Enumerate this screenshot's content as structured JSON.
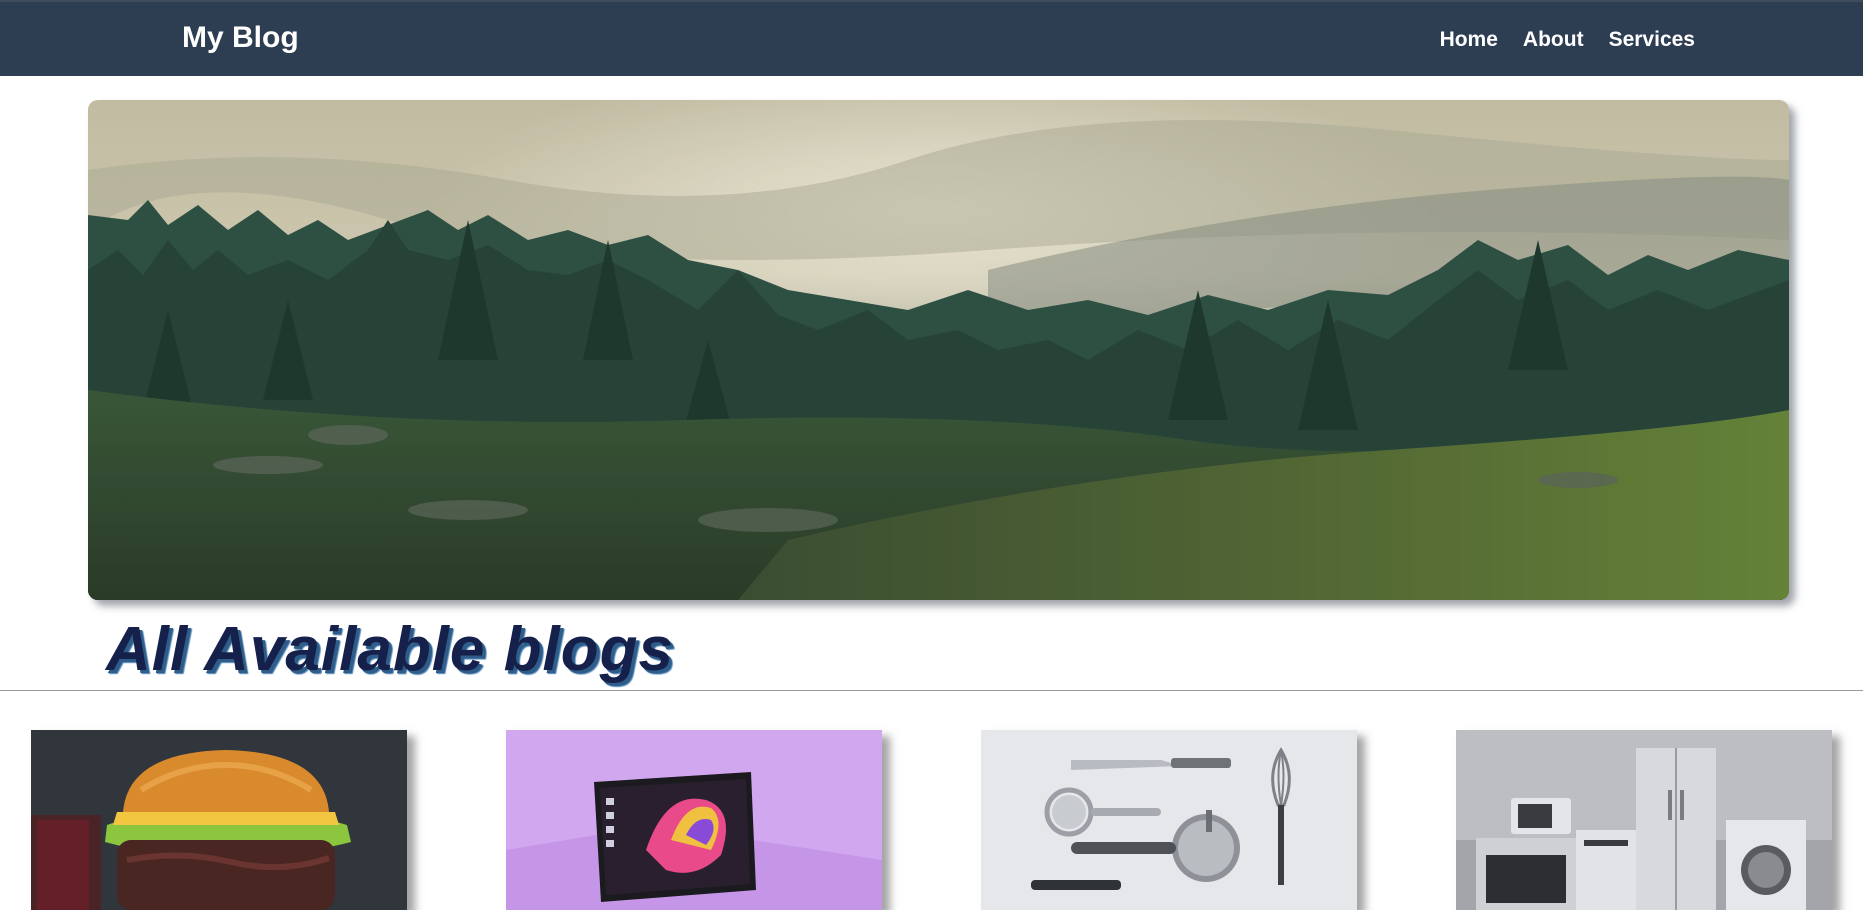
{
  "navbar": {
    "brand": "My Blog",
    "links": [
      {
        "label": "Home"
      },
      {
        "label": "About"
      },
      {
        "label": "Services"
      }
    ],
    "background": "#2e3e52"
  },
  "hero": {
    "image": "forest-landscape-image"
  },
  "section": {
    "title": "All Available blogs",
    "title_color": "#15204b"
  },
  "cards": [
    {
      "image": "burger-image"
    },
    {
      "image": "laptop-image"
    },
    {
      "image": "kitchen-utensils-image"
    },
    {
      "image": "home-appliances-image"
    }
  ]
}
